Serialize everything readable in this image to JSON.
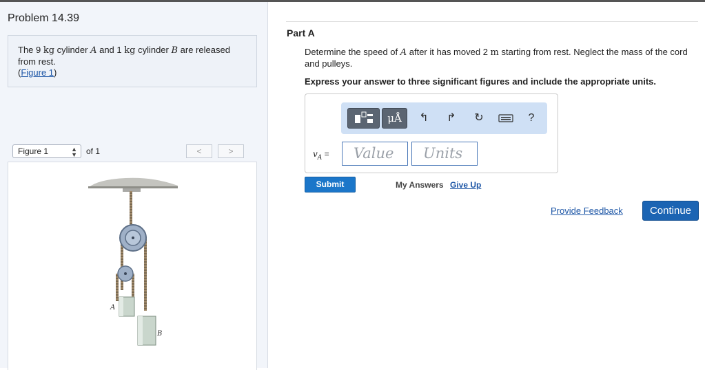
{
  "problem": {
    "title": "Problem 14.39",
    "statement": {
      "t1": "The 9 ",
      "u1": "kg",
      "t2": " cylinder ",
      "v1": "A",
      "t3": " and 1 ",
      "u2": "kg",
      "t4": " cylinder ",
      "v2": "B",
      "t5": " are released from rest.",
      "link_open": "(",
      "link_text": "Figure 1",
      "link_close": ")"
    }
  },
  "figure": {
    "select_value": "Figure 1",
    "of_label": "of 1",
    "prev_label": "<",
    "next_label": ">",
    "label_a": "A",
    "label_b": "B"
  },
  "part": {
    "title": "Part A",
    "question": {
      "t1": "Determine the speed of ",
      "v1": "A",
      "t2": " after it has moved 2 ",
      "u1": "m",
      "t3": " starting from rest. Neglect the mass of the cord and pulleys."
    },
    "instruction": "Express your answer to three significant figures and include the appropriate units.",
    "toolbar": {
      "units_button": "μÅ",
      "help_icon": "?"
    },
    "answer": {
      "var": "vA",
      "eq": " =",
      "value_placeholder": "Value",
      "units_placeholder": "Units"
    },
    "submit_label": "Submit",
    "my_answers_label": "My Answers",
    "give_up_label": "Give Up"
  },
  "footer": {
    "feedback_label": "Provide Feedback",
    "continue_label": "Continue"
  },
  "colors": {
    "accent": "#1b76c9",
    "toolbar_bg": "#cfe0f5",
    "link": "#1d56a6"
  }
}
